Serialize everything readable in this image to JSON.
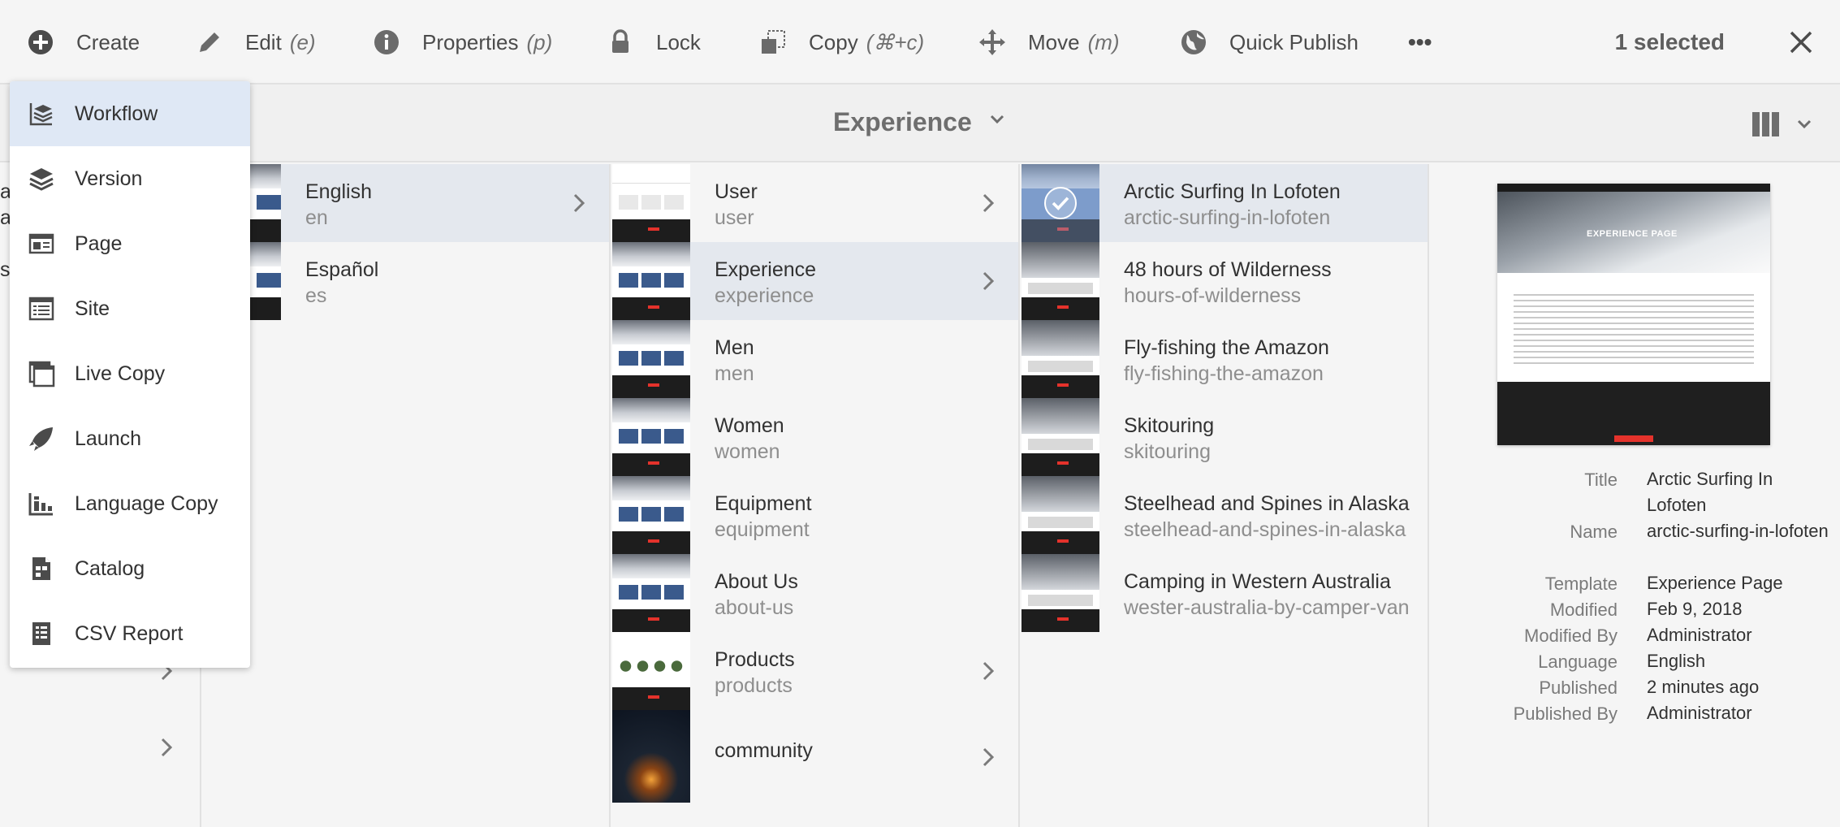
{
  "toolbar": {
    "create": "Create",
    "edit": "Edit",
    "edit_key": "(e)",
    "properties": "Properties",
    "properties_key": "(p)",
    "lock": "Lock",
    "copy": "Copy",
    "copy_key": "(⌘+c)",
    "move": "Move",
    "move_key": "(m)",
    "quick_publish": "Quick Publish",
    "more": "•••",
    "selected": "1 selected"
  },
  "title": "Experience",
  "create_menu": [
    {
      "label": "Workflow",
      "icon": "workflow-icon"
    },
    {
      "label": "Version",
      "icon": "version-icon"
    },
    {
      "label": "Page",
      "icon": "page-icon"
    },
    {
      "label": "Site",
      "icon": "site-icon"
    },
    {
      "label": "Live Copy",
      "icon": "live-copy-icon"
    },
    {
      "label": "Launch",
      "icon": "launch-icon"
    },
    {
      "label": "Language Copy",
      "icon": "language-copy-icon"
    },
    {
      "label": "Catalog",
      "icon": "catalog-icon"
    },
    {
      "label": "CSV Report",
      "icon": "csv-report-icon"
    }
  ],
  "left_fragments": [
    "a",
    "a",
    "s"
  ],
  "col_languages": [
    {
      "title": "English",
      "name": "en",
      "active": true,
      "chevron": true
    },
    {
      "title": "Español",
      "name": "es",
      "active": false,
      "chevron": false
    }
  ],
  "col_sections": [
    {
      "title": "User",
      "name": "user",
      "chevron": true
    },
    {
      "title": "Experience",
      "name": "experience",
      "chevron": true,
      "active": true
    },
    {
      "title": "Men",
      "name": "men",
      "chevron": false
    },
    {
      "title": "Women",
      "name": "women",
      "chevron": false
    },
    {
      "title": "Equipment",
      "name": "equipment",
      "chevron": false
    },
    {
      "title": "About Us",
      "name": "about-us",
      "chevron": false
    },
    {
      "title": "Products",
      "name": "products",
      "chevron": true
    },
    {
      "title": "community",
      "name": "",
      "chevron": true
    }
  ],
  "col_pages": [
    {
      "title": "Arctic Surfing In Lofoten",
      "name": "arctic-surfing-in-lofoten",
      "selected": true
    },
    {
      "title": "48 hours of Wilderness",
      "name": "hours-of-wilderness"
    },
    {
      "title": "Fly-fishing the Amazon",
      "name": "fly-fishing-the-amazon"
    },
    {
      "title": "Skitouring",
      "name": "skitouring"
    },
    {
      "title": "Steelhead and Spines in Alaska",
      "name": "steelhead-and-spines-in-alaska"
    },
    {
      "title": "Camping in Western Australia",
      "name": "wester-australia-by-camper-van"
    }
  ],
  "detail": {
    "preview_heading": "EXPERIENCE PAGE",
    "meta": [
      {
        "label": "Title",
        "value": "Arctic Surfing In Lofoten"
      },
      {
        "label": "Name",
        "value": "arctic-surfing-in-lofoten"
      },
      {
        "label": "Template",
        "value": "Experience Page"
      },
      {
        "label": "Modified",
        "value": "Feb 9, 2018"
      },
      {
        "label": "Modified By",
        "value": "Administrator"
      },
      {
        "label": "Language",
        "value": "English"
      },
      {
        "label": "Published",
        "value": "2 minutes ago"
      },
      {
        "label": "Published By",
        "value": "Administrator"
      }
    ]
  }
}
